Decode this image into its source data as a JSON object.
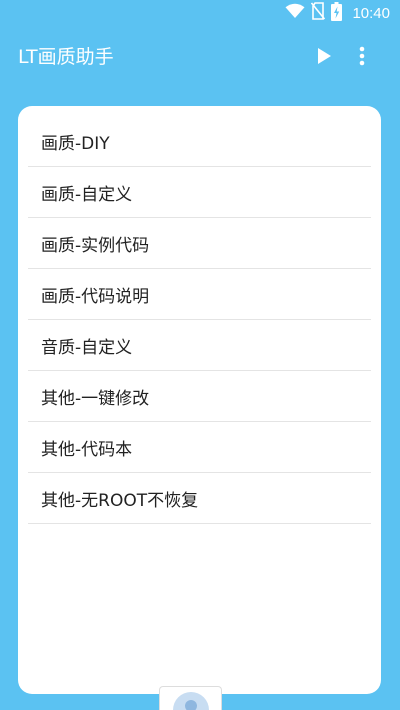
{
  "status_bar": {
    "time": "10:40",
    "icons": [
      "wifi-icon",
      "no-sim-icon",
      "battery-charging-icon"
    ]
  },
  "app_bar": {
    "title": "LT画质助手",
    "actions": [
      "play-icon",
      "more-vert-icon"
    ]
  },
  "menu": {
    "items": [
      {
        "label": "画质-DIY"
      },
      {
        "label": "画质-自定义"
      },
      {
        "label": "画质-实例代码"
      },
      {
        "label": "画质-代码说明"
      },
      {
        "label": "音质-自定义"
      },
      {
        "label": "其他-一键修改"
      },
      {
        "label": "其他-代码本"
      },
      {
        "label": "其他-无ROOT不恢复"
      }
    ]
  },
  "colors": {
    "background": "#5bc2f2",
    "card": "#ffffff",
    "text": "#222222",
    "divider": "#e4e4e4"
  }
}
